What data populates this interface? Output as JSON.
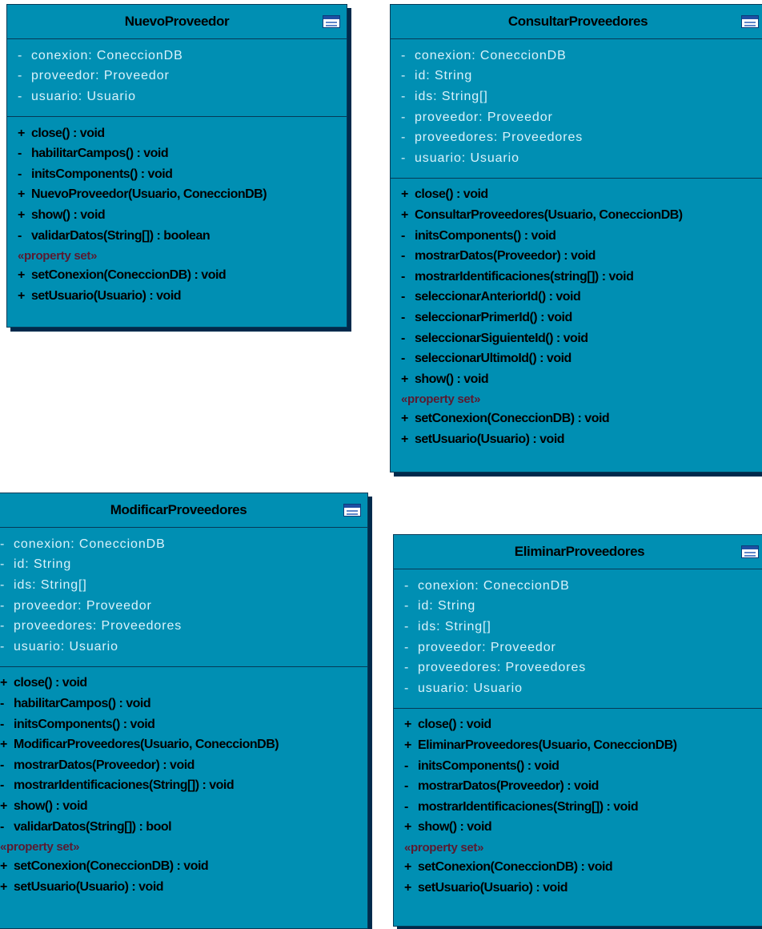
{
  "classes": [
    {
      "name": "NuevoProveedor",
      "attributes": [
        {
          "vis": "-",
          "text": "conexion: ConeccionDB"
        },
        {
          "vis": "-",
          "text": "proveedor: Proveedor"
        },
        {
          "vis": "-",
          "text": "usuario: Usuario"
        }
      ],
      "operations": [
        {
          "vis": "+",
          "text": "close() : void"
        },
        {
          "vis": "-",
          "text": "habilitarCampos() : void"
        },
        {
          "vis": "-",
          "text": "initsComponents() : void"
        },
        {
          "vis": "+",
          "text": "NuevoProveedor(Usuario, ConeccionDB)"
        },
        {
          "vis": "+",
          "text": "show() : void"
        },
        {
          "vis": "-",
          "text": "validarDatos(String[]) : boolean"
        }
      ],
      "stereotype": "«property set»",
      "setters": [
        {
          "vis": "+",
          "text": "setConexion(ConeccionDB) : void"
        },
        {
          "vis": "+",
          "text": "setUsuario(Usuario) : void"
        }
      ]
    },
    {
      "name": "ConsultarProveedores",
      "attributes": [
        {
          "vis": "-",
          "text": "conexion: ConeccionDB"
        },
        {
          "vis": "-",
          "text": "id: String"
        },
        {
          "vis": "-",
          "text": "ids: String[]"
        },
        {
          "vis": "-",
          "text": "proveedor: Proveedor"
        },
        {
          "vis": "-",
          "text": "proveedores: Proveedores"
        },
        {
          "vis": "-",
          "text": "usuario: Usuario"
        }
      ],
      "operations": [
        {
          "vis": "+",
          "text": "close() : void"
        },
        {
          "vis": "+",
          "text": "ConsultarProveedores(Usuario, ConeccionDB)"
        },
        {
          "vis": "-",
          "text": "initsComponents() : void"
        },
        {
          "vis": "-",
          "text": "mostrarDatos(Proveedor) : void"
        },
        {
          "vis": "-",
          "text": "mostrarIdentificaciones(string[]) : void"
        },
        {
          "vis": "-",
          "text": "seleccionarAnteriorId() : void"
        },
        {
          "vis": "-",
          "text": "seleccionarPrimerId() : void"
        },
        {
          "vis": "-",
          "text": "seleccionarSiguienteId() : void"
        },
        {
          "vis": "-",
          "text": "seleccionarUltimoId() : void"
        },
        {
          "vis": "+",
          "text": "show() : void"
        }
      ],
      "stereotype": "«property set»",
      "setters": [
        {
          "vis": "+",
          "text": "setConexion(ConeccionDB) : void"
        },
        {
          "vis": "+",
          "text": "setUsuario(Usuario) : void"
        }
      ]
    },
    {
      "name": "ModificarProveedores",
      "attributes": [
        {
          "vis": "-",
          "text": "conexion: ConeccionDB"
        },
        {
          "vis": "-",
          "text": "id: String"
        },
        {
          "vis": "-",
          "text": "ids: String[]"
        },
        {
          "vis": "-",
          "text": "proveedor: Proveedor"
        },
        {
          "vis": "-",
          "text": "proveedores: Proveedores"
        },
        {
          "vis": "-",
          "text": "usuario: Usuario"
        }
      ],
      "operations": [
        {
          "vis": "+",
          "text": "close() : void"
        },
        {
          "vis": "-",
          "text": "habilitarCampos() : void"
        },
        {
          "vis": "-",
          "text": "initsComponents() : void"
        },
        {
          "vis": "+",
          "text": "ModificarProveedores(Usuario, ConeccionDB)"
        },
        {
          "vis": "-",
          "text": "mostrarDatos(Proveedor) : void"
        },
        {
          "vis": "-",
          "text": "mostrarIdentificaciones(String[]) : void"
        },
        {
          "vis": "+",
          "text": "show() : void"
        },
        {
          "vis": "-",
          "text": "validarDatos(String[]) : bool"
        }
      ],
      "stereotype": "«property set»",
      "setters": [
        {
          "vis": "+",
          "text": "setConexion(ConeccionDB) : void"
        },
        {
          "vis": "+",
          "text": "setUsuario(Usuario) : void"
        }
      ]
    },
    {
      "name": "EliminarProveedores",
      "attributes": [
        {
          "vis": "-",
          "text": "conexion: ConeccionDB"
        },
        {
          "vis": "-",
          "text": "id: String"
        },
        {
          "vis": "-",
          "text": "ids: String[]"
        },
        {
          "vis": "-",
          "text": "proveedor: Proveedor"
        },
        {
          "vis": "-",
          "text": "proveedores: Proveedores"
        },
        {
          "vis": "-",
          "text": "usuario: Usuario"
        }
      ],
      "operations": [
        {
          "vis": "+",
          "text": "close() : void"
        },
        {
          "vis": "+",
          "text": "EliminarProveedores(Usuario, ConeccionDB)"
        },
        {
          "vis": "-",
          "text": "initsComponents() : void"
        },
        {
          "vis": "-",
          "text": "mostrarDatos(Proveedor) : void"
        },
        {
          "vis": "-",
          "text": "mostrarIdentificaciones(String[]) : void"
        },
        {
          "vis": "+",
          "text": "show() : void"
        }
      ],
      "stereotype": "«property set»",
      "setters": [
        {
          "vis": "+",
          "text": "setConexion(ConeccionDB) : void"
        },
        {
          "vis": "+",
          "text": "setUsuario(Usuario) : void"
        }
      ]
    }
  ]
}
